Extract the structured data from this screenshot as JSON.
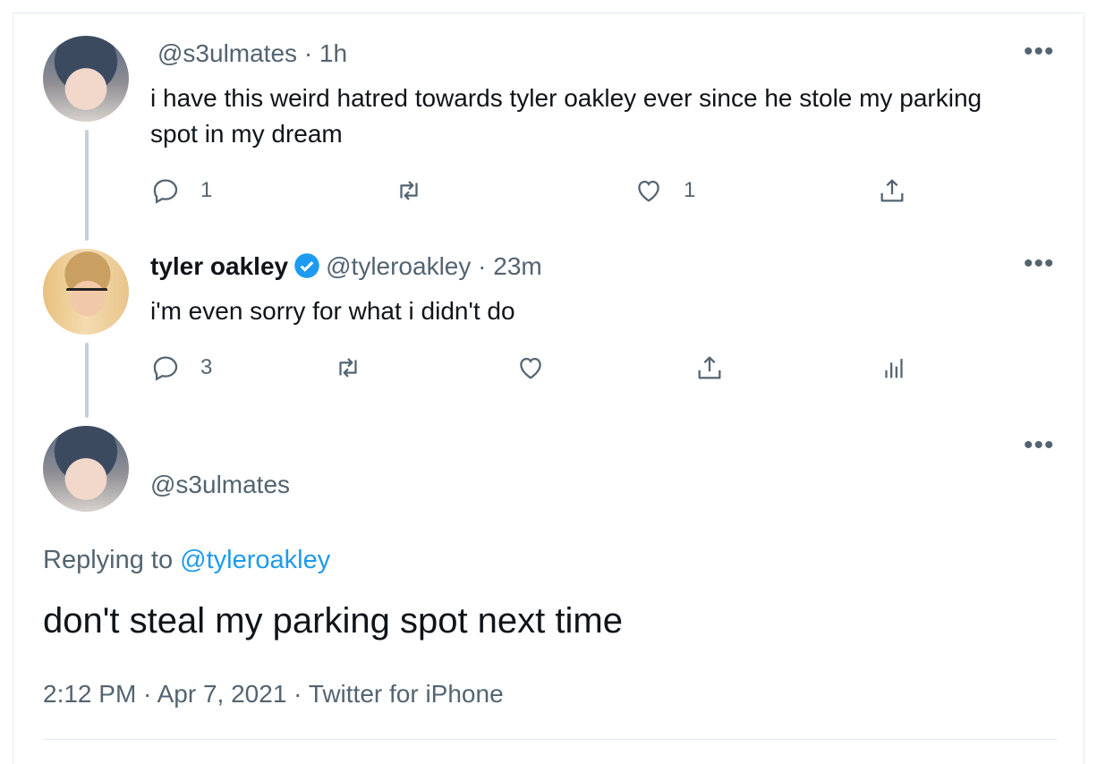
{
  "tweet1": {
    "handle_time": "@s3ulmates · 1h",
    "text": "i have this weird hatred towards tyler oakley ever since he stole my parking spot in my dream",
    "reply_count": "1",
    "like_count": "1"
  },
  "tweet2": {
    "name": "tyler oakley",
    "handle_time": "@tyleroakley · 23m",
    "text": "i'm even sorry for what i didn't do",
    "reply_count": "3"
  },
  "main": {
    "handle": "@s3ulmates",
    "replying_prefix": "Replying to",
    "replying_handle": "@tyleroakley",
    "text": "don't steal my parking spot next time",
    "meta": "2:12 PM · Apr 7, 2021 · Twitter for iPhone"
  },
  "colors": {
    "accent": "#1d9bf0",
    "muted": "#536471",
    "thread": "#c4cfd6"
  },
  "icons": [
    "reply-icon",
    "retweet-icon",
    "like-icon",
    "share-icon",
    "analytics-icon",
    "verified-icon",
    "more-icon"
  ]
}
